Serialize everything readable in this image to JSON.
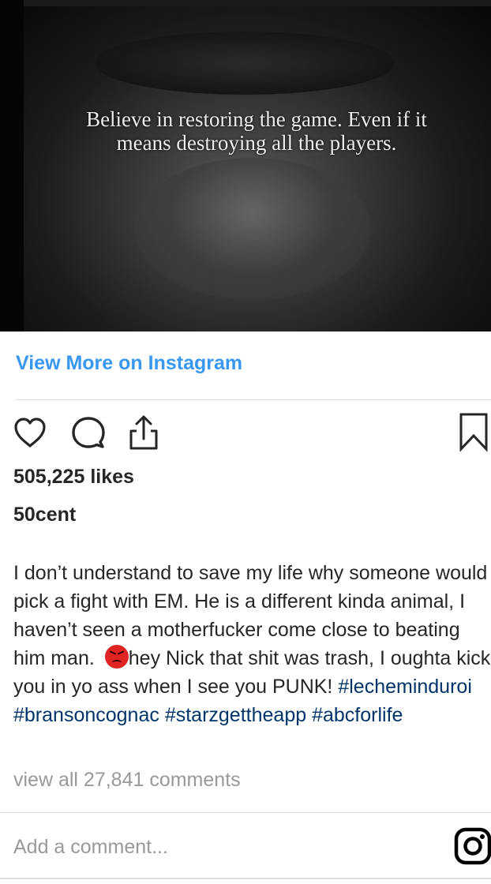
{
  "post": {
    "quote_line1": "Believe in restoring the game. Even if it",
    "quote_line2": "means destroying all the players."
  },
  "view_more_label": "View More on Instagram",
  "actions": {
    "like_icon": "heart-icon",
    "comment_icon": "comment-icon",
    "share_icon": "share-icon",
    "save_icon": "bookmark-icon"
  },
  "likes_text": "505,225 likes",
  "username": "50cent",
  "caption": {
    "text_1": "I don’t understand to save my life why someone would pick a fight with EM. He is a different kinda animal, I haven’t seen a motherfucker come close to beating him man.",
    "emoji": "angry-face",
    "text_2": "hey Nick that shit was trash, I oughta kick you in yo ass when I see you PUNK!",
    "hashtags": [
      "#lecheminduroi",
      "#bransoncognac",
      "#starzgettheapp",
      "#abcforlife"
    ]
  },
  "view_comments_label": "view all 27,841 comments",
  "add_comment_placeholder": "Add a comment...",
  "brand_icon": "instagram-icon",
  "colors": {
    "link_blue": "#3897f0",
    "hashtag_blue": "#003569",
    "muted_gray": "#999999",
    "text": "#262626",
    "divider": "#dbdbdb"
  }
}
